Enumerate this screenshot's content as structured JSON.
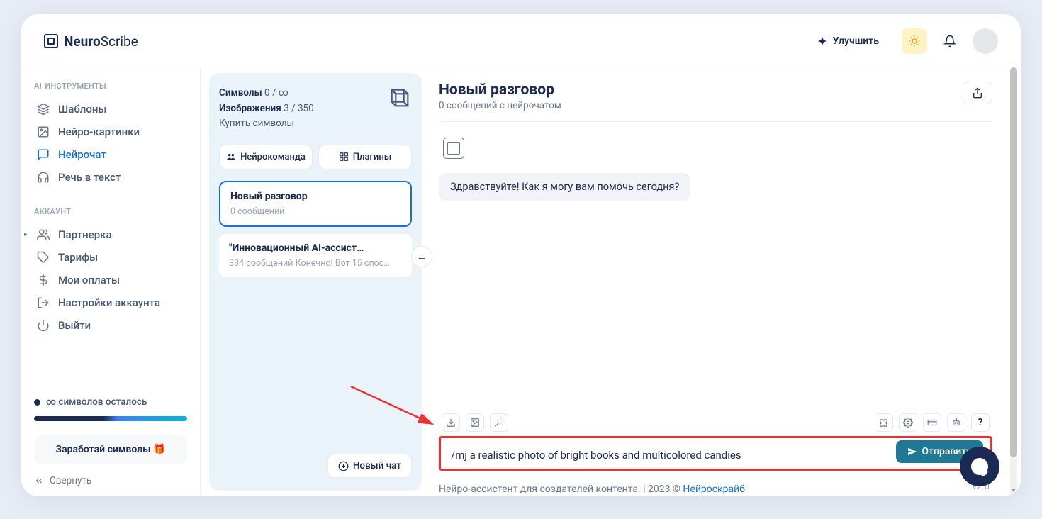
{
  "header": {
    "brand_a": "Neuro",
    "brand_b": "Scribe",
    "upgrade": "Улучшить"
  },
  "sidebar": {
    "tools_label": "AI-ИНСТРУМЕНТЫ",
    "tools": [
      {
        "label": "Шаблоны"
      },
      {
        "label": "Нейро-картинки"
      },
      {
        "label": "Нейрочат"
      },
      {
        "label": "Речь в текст"
      }
    ],
    "account_label": "АККАУНТ",
    "account": [
      {
        "label": "Партнерка"
      },
      {
        "label": "Тарифы"
      },
      {
        "label": "Мои оплаты"
      },
      {
        "label": "Настройки аккаунта"
      },
      {
        "label": "Выйти"
      }
    ],
    "credits": "∞ символов осталось",
    "earn": "Заработай символы 🎁",
    "collapse": "Свернуть"
  },
  "panel": {
    "symbols_label": "Символы",
    "symbols_value": "0 / ∞",
    "images_label": "Изображения",
    "images_value": "3 / 350",
    "buy": "Купить символы",
    "tab_team": "Нейрокоманда",
    "tab_plugins": "Плагины",
    "chats": [
      {
        "title": "Новый разговор",
        "sub": "0 сообщений"
      },
      {
        "title": "\"Инновационный AI-ассист…",
        "sub": "334 сообщений Конечно! Вот 15 спос…"
      }
    ],
    "new_chat": "Новый чат"
  },
  "chat": {
    "title": "Новый разговор",
    "subtitle": "0 сообщений с нейрочатом",
    "greeting": "Здравствуйте! Как я могу вам помочь сегодня?",
    "input_value": "/mj a realistic photo of bright books and multicolored candies",
    "send": "Отправить"
  },
  "footer": {
    "text": "Нейро-ассистент для создателей контента.  | 2023 © ",
    "link": "Нейроскрайб",
    "version": "v2.0"
  }
}
